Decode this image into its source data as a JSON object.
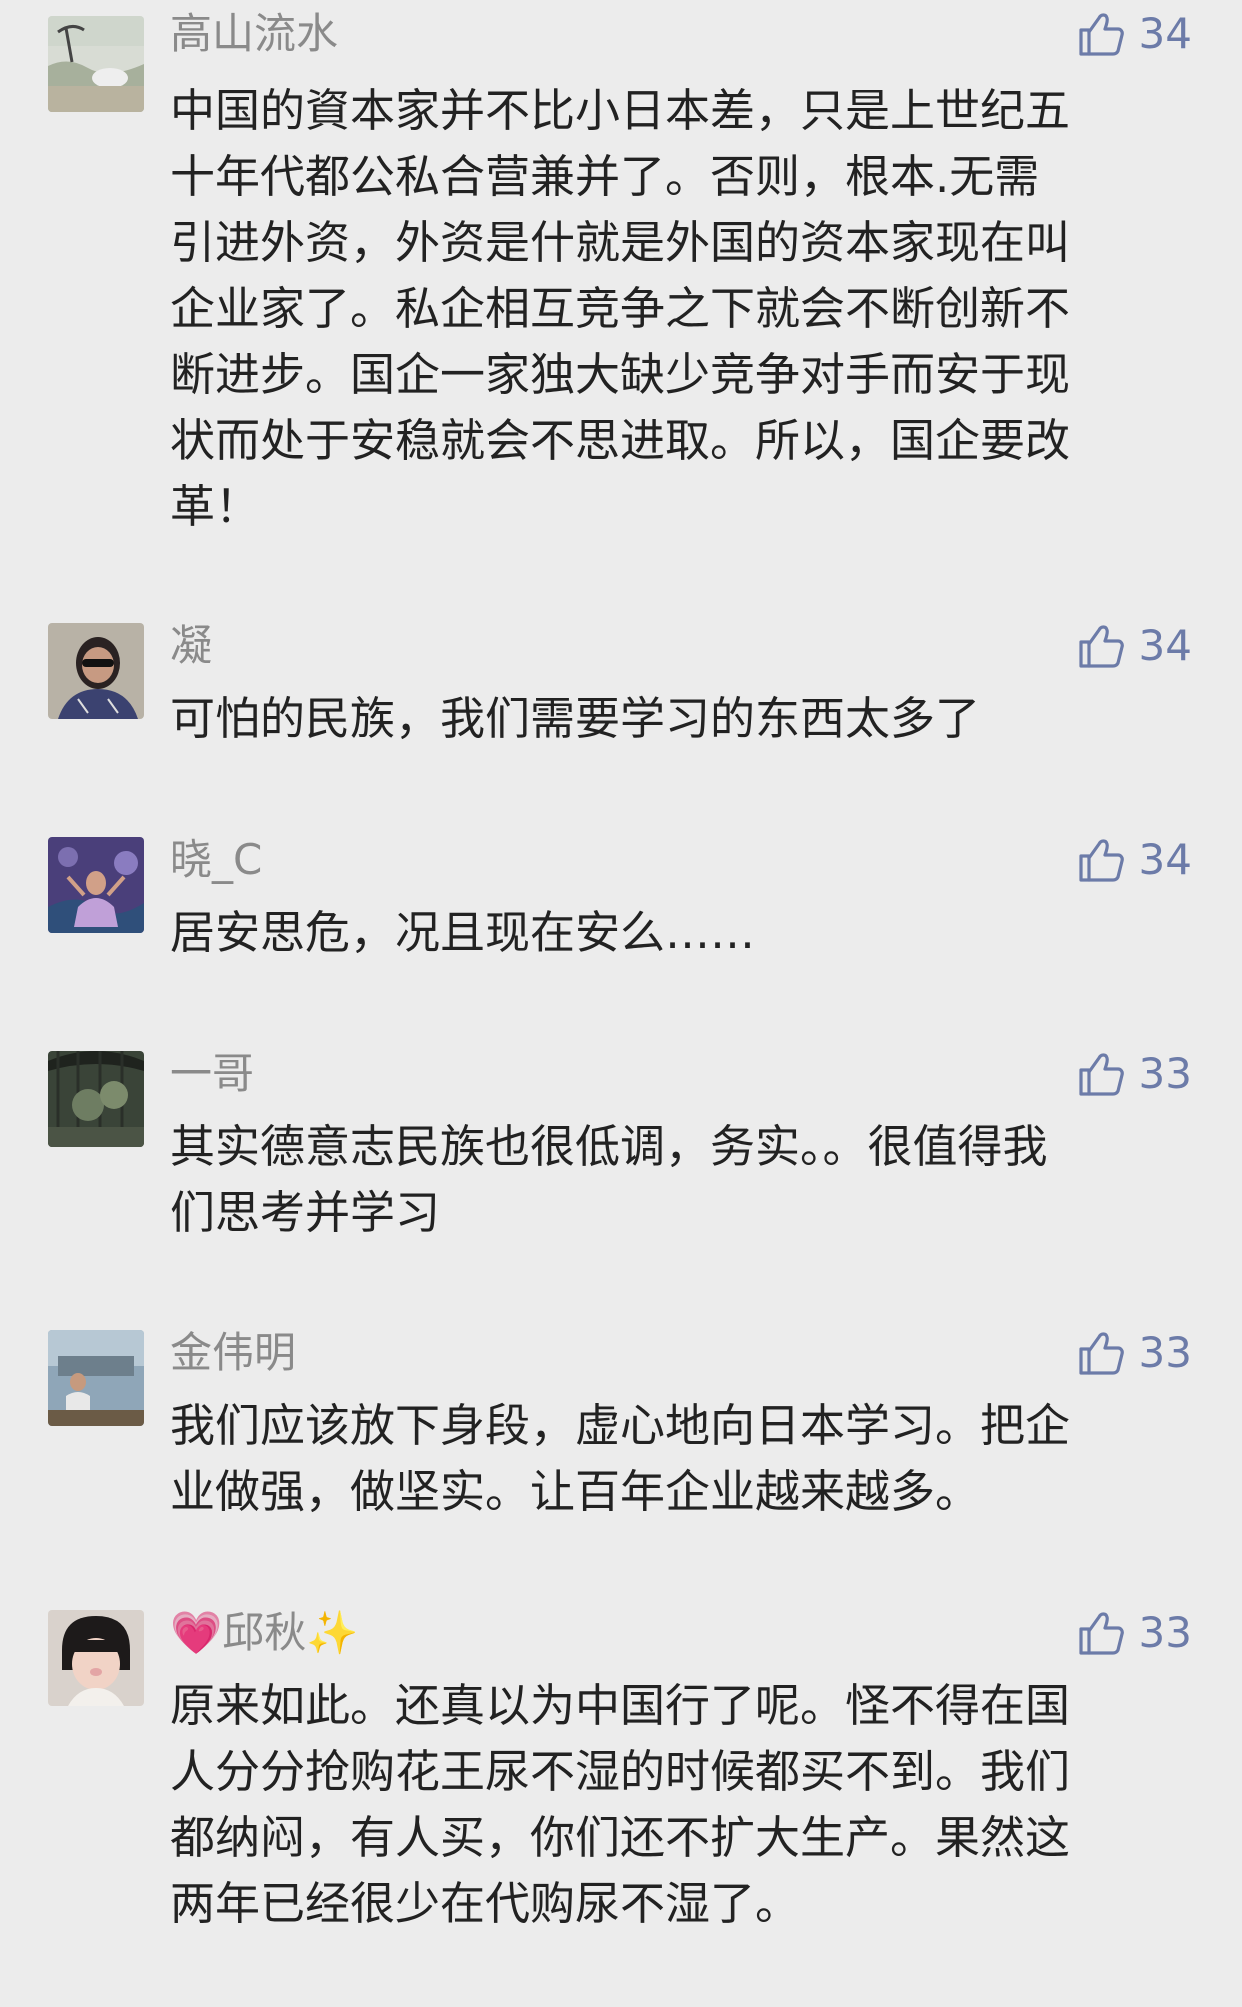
{
  "comments": [
    {
      "username": "高山流水",
      "likes": "34",
      "text": "中国的資本家并不比小日本差，只是上世纪五\n十年代都公私合营兼并了。否则，根本.无需\n引进外资，外资是什就是外国的资本家现在叫\n企业家了。私企相互竞争之下就会不断创新不\n断进步。国企一家独大缺少竞争对手而安于现\n状而处于安稳就会不思进取。所以，国企要改\n革！"
    },
    {
      "username": "凝",
      "likes": "34",
      "text": "可怕的民族，我们需要学习的东西太多了"
    },
    {
      "username": "晓_C",
      "likes": "34",
      "text": "居安思危，况且现在安么……"
    },
    {
      "username": "一哥",
      "likes": "33",
      "text": "其实德意志民族也很低调，务实。。很值得我\n们思考并学习"
    },
    {
      "username": "金伟明",
      "likes": "33",
      "text": "我们应该放下身段，虚心地向日本学习。把企\n业做强，做坚实。让百年企业越来越多。"
    },
    {
      "username_prefix": "💗",
      "username": "邱秋",
      "username_suffix": "✨",
      "likes": "33",
      "text": "原来如此。还真以为中国行了呢。怪不得在国\n人分分抢购花王尿不湿的时候都买不到。我们\n都纳闷，有人买，你们还不扩大生产。果然这\n两年已经很少在代购尿不湿了。"
    }
  ],
  "icons": {
    "like": "thumbs-up-icon"
  },
  "colors": {
    "background": "#ececec",
    "username": "#8a8a8a",
    "like_accent": "#6c7ba8",
    "text": "#222222"
  }
}
